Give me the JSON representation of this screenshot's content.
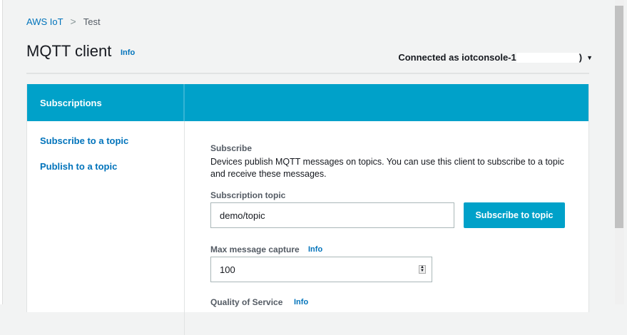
{
  "breadcrumb": {
    "root": "AWS IoT",
    "separator": ">",
    "current": "Test"
  },
  "header": {
    "title": "MQTT client",
    "info": "Info",
    "connection_prefix": "Connected as iotconsole-1",
    "connection_suffix": ")"
  },
  "panel": {
    "header": "Subscriptions",
    "sidebar": [
      "Subscribe to a topic",
      "Publish to a topic"
    ],
    "subscribe": {
      "heading": "Subscribe",
      "description": "Devices publish MQTT messages on topics. You can use this client to subscribe to a topic and receive these messages.",
      "topic_label": "Subscription topic",
      "topic_value": "demo/topic",
      "button": "Subscribe to topic",
      "max_label": "Max message capture",
      "max_info": "Info",
      "max_value": "100",
      "qos_label": "Quality of Service",
      "qos_info": "Info"
    }
  }
}
